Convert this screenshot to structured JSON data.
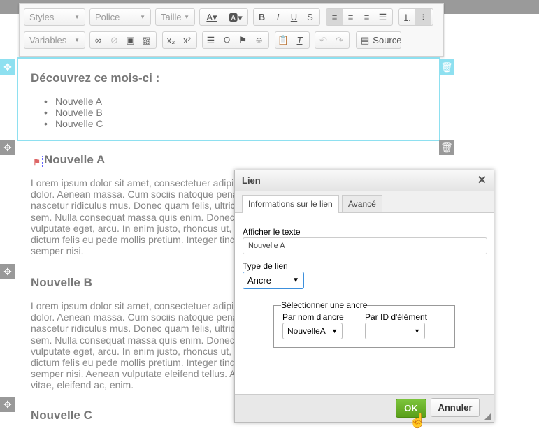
{
  "toolbar": {
    "styles": "Styles",
    "font": "Police",
    "size": "Taille",
    "variables": "Variables",
    "source": "Source",
    "icons": [
      "text-color",
      "bg-color",
      "bold",
      "italic",
      "underline",
      "strike",
      "align-left",
      "align-center",
      "align-right",
      "justify",
      "numbered-list",
      "bulleted-list",
      "link",
      "unlink",
      "textfield",
      "image",
      "subscript",
      "superscript",
      "horizontal-line",
      "special-char",
      "anchor",
      "smiley",
      "paste-text",
      "remove-format",
      "undo",
      "redo",
      "source"
    ]
  },
  "content": {
    "intro_title": "Découvrez ce mois-ci :",
    "intro_items": [
      "Nouvelle A",
      "Nouvelle B",
      "Nouvelle C"
    ],
    "sections": [
      {
        "title": "Nouvelle A",
        "lines": [
          "Lorem ipsum dolor sit amet, consectetuer adipi",
          "dolor. Aenean massa. Cum sociis natoque pena",
          "nascetur ridiculus mus. Donec quam felis, ultric",
          "sem. Nulla consequat massa quis enim. Donec",
          "vulputate eget, arcu. In enim justo, rhoncus ut,",
          "dictum felis eu pede mollis pretium. Integer tinc",
          "semper nisi."
        ]
      },
      {
        "title": "Nouvelle B",
        "lines": [
          "Lorem ipsum dolor sit amet, consectetuer adipi",
          "dolor. Aenean massa. Cum sociis natoque pena",
          "nascetur ridiculus mus. Donec quam felis, ultric",
          "sem. Nulla consequat massa quis enim. Donec",
          "vulputate eget, arcu. In enim justo, rhoncus ut,",
          "dictum felis eu pede mollis pretium. Integer tinc",
          "semper nisi. Aenean vulputate eleifend tellus. A",
          "vitae, eleifend ac, enim."
        ]
      },
      {
        "title": "Nouvelle C"
      }
    ]
  },
  "dialog": {
    "title": "Lien",
    "tabs": [
      "Informations sur le lien",
      "Avancé"
    ],
    "display_text_label": "Afficher le texte",
    "display_text_value": "Nouvelle A",
    "link_type_label": "Type de lien",
    "link_type_value": "Ancre",
    "anchor_legend": "Sélectionner une ancre",
    "by_name_label": "Par nom d'ancre",
    "by_name_value": "NouvelleA",
    "by_id_label": "Par ID d'élément",
    "by_id_value": "",
    "ok": "OK",
    "cancel": "Annuler"
  },
  "colors": {
    "selection": "#8ee0f0",
    "ok_button": "#6bb22a"
  }
}
